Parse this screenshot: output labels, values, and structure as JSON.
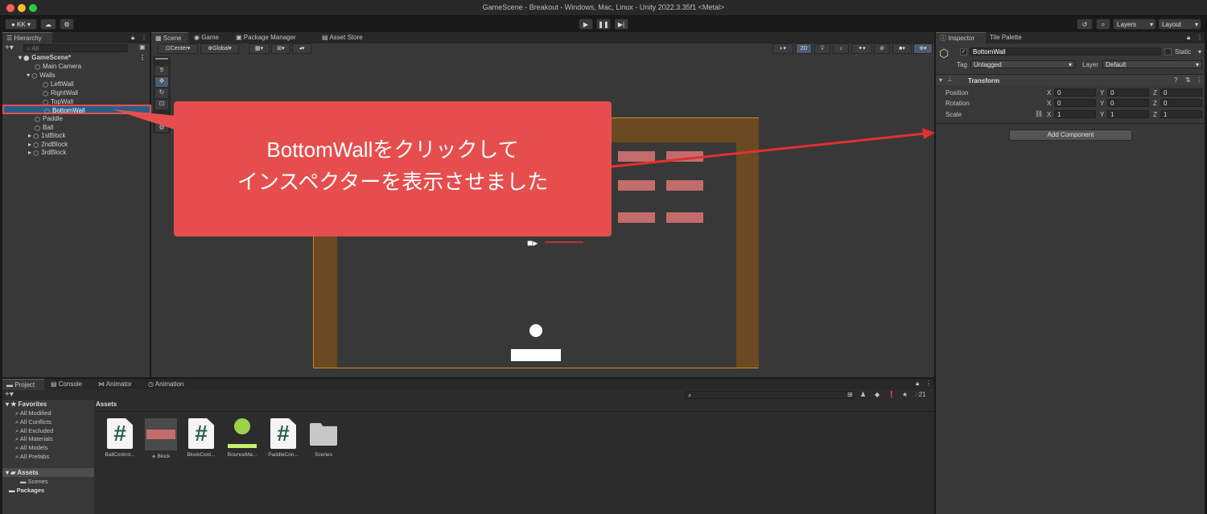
{
  "window": {
    "title": "GameScene - Breakout - Windows, Mac, Linux - Unity 2022.3.35f1 <Metal>"
  },
  "toolbar": {
    "account": "KK",
    "layers": "Layers",
    "layout": "Layout"
  },
  "hierarchy": {
    "tab": "Hierarchy",
    "search_placeholder": "All",
    "items": [
      {
        "label": "GameScene*"
      },
      {
        "label": "Main Camera"
      },
      {
        "label": "Walls"
      },
      {
        "label": "LeftWall"
      },
      {
        "label": "RightWall"
      },
      {
        "label": "TopWall"
      },
      {
        "label": "BottomWall"
      },
      {
        "label": "Paddle"
      },
      {
        "label": "Ball"
      },
      {
        "label": "1stBlock"
      },
      {
        "label": "2ndBlock"
      },
      {
        "label": "3rdBlock"
      }
    ]
  },
  "scene": {
    "tabs": [
      {
        "label": "Scene"
      },
      {
        "label": "Game"
      },
      {
        "label": "Package Manager"
      },
      {
        "label": "Asset Store"
      }
    ],
    "pivot": "Center",
    "space": "Global",
    "mode_2d": "2D"
  },
  "inspector": {
    "tabs": [
      {
        "label": "Inspector"
      },
      {
        "label": "Tile Palette"
      }
    ],
    "object_name": "BottomWall",
    "static_label": "Static",
    "tag_label": "Tag",
    "tag_value": "Untagged",
    "layer_label": "Layer",
    "layer_value": "Default",
    "component": "Transform",
    "position": {
      "label": "Position",
      "x": "0",
      "y": "0",
      "z": "0"
    },
    "rotation": {
      "label": "Rotation",
      "x": "0",
      "y": "0",
      "z": "0"
    },
    "scale": {
      "label": "Scale",
      "x": "1",
      "y": "1",
      "z": "1"
    },
    "axis": {
      "x": "X",
      "y": "Y",
      "z": "Z"
    },
    "add_component": "Add Component"
  },
  "bottom": {
    "tabs": [
      {
        "label": "Project"
      },
      {
        "label": "Console"
      },
      {
        "label": "Animator"
      },
      {
        "label": "Animation"
      }
    ],
    "hidden_count": "21",
    "favorites_title": "Favorites",
    "favorites": [
      {
        "label": "All Modified"
      },
      {
        "label": "All Conflicts"
      },
      {
        "label": "All Excluded"
      },
      {
        "label": "All Materials"
      },
      {
        "label": "All Models"
      },
      {
        "label": "All Prefabs"
      }
    ],
    "assets_title": "Assets",
    "assets_children": [
      {
        "label": "Scenes"
      }
    ],
    "packages": "Packages",
    "breadcrumb": "Assets",
    "files": [
      {
        "label": "BallControl..."
      },
      {
        "label": "Block"
      },
      {
        "label": "BlockCont..."
      },
      {
        "label": "BounceMa..."
      },
      {
        "label": "PaddleCon..."
      },
      {
        "label": "Scenes"
      }
    ]
  },
  "annotation": {
    "line1": "BottomWallをクリックして",
    "line2": "インスペクターを表示させました"
  },
  "colors": {
    "callout": "#e64e4e",
    "wall": "#6b4a22",
    "block": "#c46c6c",
    "selection": "#2c5d87"
  }
}
